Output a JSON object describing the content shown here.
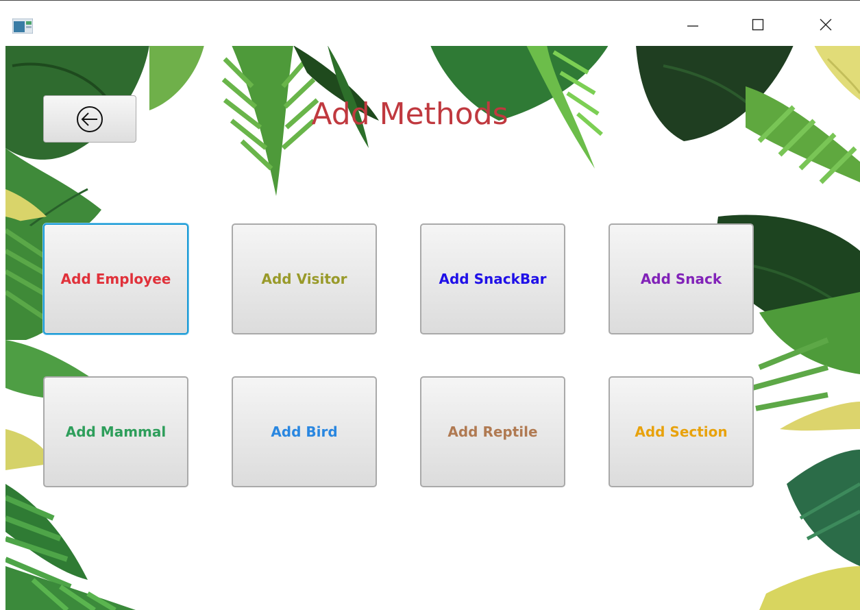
{
  "window": {
    "controls": [
      "minimize",
      "maximize",
      "close"
    ],
    "app_icon": "app-window-icon"
  },
  "page": {
    "title": "Add Methods",
    "title_color": "#c0393f",
    "back_icon": "arrow-left-circle-icon"
  },
  "buttons": [
    {
      "label": "Add Employee",
      "color": "#e0313a",
      "focused": true
    },
    {
      "label": "Add Visitor",
      "color": "#999a2a",
      "focused": false
    },
    {
      "label": "Add SnackBar",
      "color": "#1f10e8",
      "focused": false
    },
    {
      "label": "Add Snack",
      "color": "#8122b8",
      "focused": false
    },
    {
      "label": "Add Mammal",
      "color": "#2e9e5b",
      "focused": false
    },
    {
      "label": "Add Bird",
      "color": "#2a87e0",
      "focused": false
    },
    {
      "label": "Add Reptile",
      "color": "#b07a52",
      "focused": false
    },
    {
      "label": "Add Section",
      "color": "#e8a20c",
      "focused": false
    }
  ],
  "background": "tropical-leaves-decoration"
}
